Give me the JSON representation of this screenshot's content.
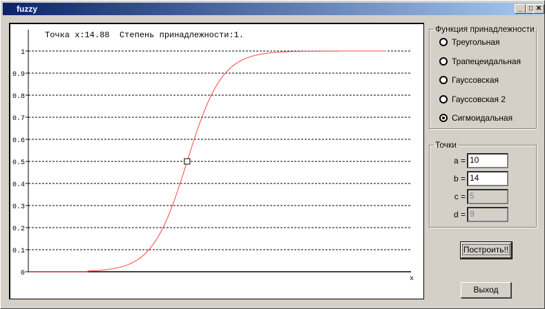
{
  "window": {
    "title": "fuzzy",
    "min": "_",
    "max": "□",
    "close": "✕"
  },
  "plot": {
    "status": "Точка x:14.88  Степень принадлежности:1.",
    "x_label": "x"
  },
  "chart_data": {
    "type": "line",
    "title": "",
    "xlabel": "x",
    "ylabel": "",
    "ylim": [
      0,
      1
    ],
    "y_ticks": [
      "0",
      "0.1",
      "0.2",
      "0.3",
      "0.4",
      "0.5",
      "0.6",
      "0.7",
      "0.8",
      "0.9",
      "1"
    ],
    "grid": "horizontal dashed",
    "xlim": [
      0,
      40
    ],
    "series": [
      {
        "name": "sigmoid",
        "function": "sigmoid",
        "center": 16.6,
        "slope": 0.55,
        "x_start": 6.2,
        "x_end": 37.5,
        "color": "#ff4040"
      }
    ],
    "marker": {
      "x": 16.6,
      "y": 0.5
    }
  },
  "membership": {
    "title": "Функция принадлежности",
    "options": [
      {
        "label": "Треугольная",
        "selected": false
      },
      {
        "label": "Трапецеидальная",
        "selected": false
      },
      {
        "label": "Гауссовская",
        "selected": false
      },
      {
        "label": "Гауссовская 2",
        "selected": false
      },
      {
        "label": "Сигмоидальная",
        "selected": true
      }
    ]
  },
  "points": {
    "title": "Точки",
    "fields": [
      {
        "label": "a =",
        "value": "10",
        "enabled": true
      },
      {
        "label": "b =",
        "value": "14",
        "enabled": true
      },
      {
        "label": "c =",
        "value": "5",
        "enabled": false
      },
      {
        "label": "d =",
        "value": "9",
        "enabled": false
      }
    ]
  },
  "buttons": {
    "build": "Построить!!",
    "exit": "Выход"
  }
}
